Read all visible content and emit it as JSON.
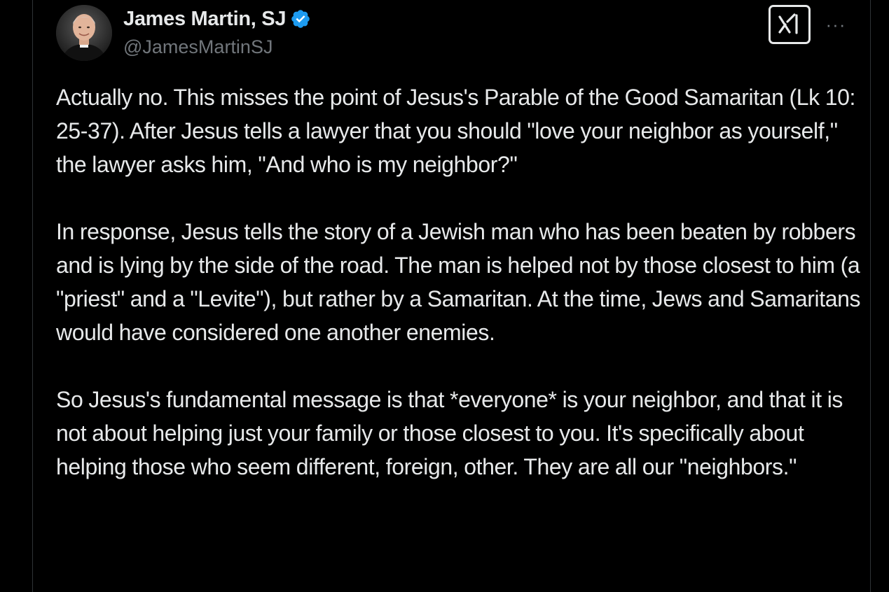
{
  "author": {
    "display_name": "James Martin, SJ",
    "handle": "@JamesMartinSJ",
    "verified": true,
    "avatar_icon": "profile-photo"
  },
  "actions": {
    "grok_icon": "grok-icon",
    "more_icon": "more-horizontal-icon",
    "more_label": "···"
  },
  "tweet": {
    "paragraphs": [
      "Actually no.  This misses the point of Jesus's Parable of the Good Samaritan (Lk 10: 25-37).  After Jesus tells a lawyer that you should \"love your neighbor as yourself,\" the lawyer asks him, \"And who is my neighbor?\"",
      "In response, Jesus tells the story of a Jewish man who has been beaten by robbers and is lying by the side of the road. The man is helped not by those closest to him (a \"priest\" and a \"Levite\"), but rather by a Samaritan. At the time, Jews and Samaritans would have considered one another enemies.",
      "So Jesus's fundamental message is that *everyone* is your neighbor, and that it is not about helping just your family or those closest to you.  It's specifically about helping those who seem different, foreign, other. They are all our \"neighbors.\""
    ]
  },
  "colors": {
    "background": "#000000",
    "text": "#e7e9ea",
    "secondary_text": "#71767b",
    "verified_blue": "#1d9bf0",
    "border": "#2f3336"
  }
}
